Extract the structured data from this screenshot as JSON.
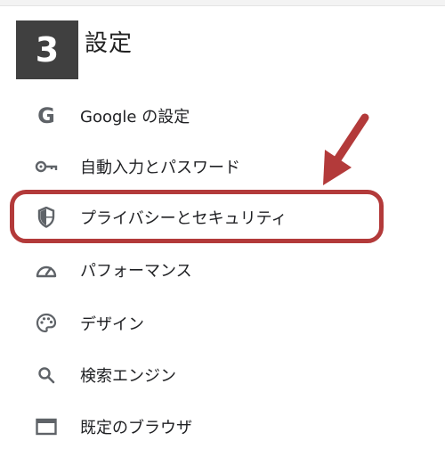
{
  "step": {
    "number": "3",
    "title": "設定"
  },
  "menu": {
    "items": [
      {
        "icon": "google-g-icon",
        "label": "Google の設定"
      },
      {
        "icon": "key-icon",
        "label": "自動入力とパスワード"
      },
      {
        "icon": "shield-icon",
        "label": "プライバシーとセキュリティ"
      },
      {
        "icon": "speedometer-icon",
        "label": "パフォーマンス"
      },
      {
        "icon": "palette-icon",
        "label": "デザイン"
      },
      {
        "icon": "search-icon",
        "label": "検索エンジン"
      },
      {
        "icon": "browser-window-icon",
        "label": "既定のブラウザ"
      }
    ]
  },
  "annotation": {
    "highlight_color": "#b33a3a",
    "highlighted_item": "プライバシーとセキュリティ"
  },
  "colors": {
    "badge_bg": "#404040",
    "icon": "#5f6368",
    "text": "#202124"
  }
}
